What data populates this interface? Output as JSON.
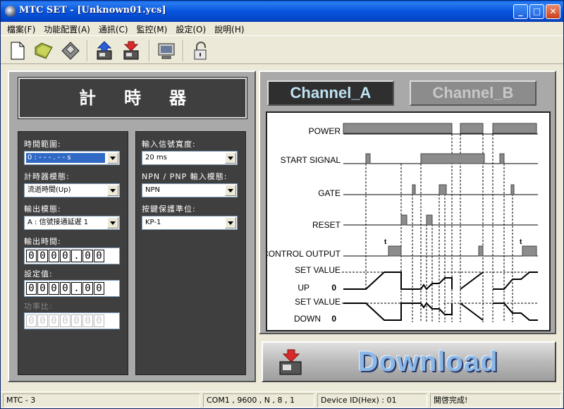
{
  "window": {
    "title": "MTC SET - [Unknown01.ycs]"
  },
  "menu": [
    "檔案(F)",
    "功能配置(A)",
    "通訊(C)",
    "監控(M)",
    "設定(O)",
    "說明(H)"
  ],
  "toolbar": {
    "icons": [
      "new-file-icon",
      "open-folder-icon",
      "save-disk-icon",
      "upload-icon",
      "download-icon",
      "monitor-icon",
      "lock-icon"
    ]
  },
  "left_panel": {
    "title": "計時器",
    "fields": {
      "time_range_label": "時間範圍:",
      "time_range_value": "0 : - - - . - -  s",
      "timer_mode_label": "計時器模態:",
      "timer_mode_value": "流逝時間(Up)",
      "output_mode_label": "輸出模態:",
      "output_mode_value": "A : 信號接通延遲 1",
      "output_time_label": "輸出時間:",
      "output_time_digits": [
        "0",
        "0",
        "0",
        "0",
        ".",
        "0",
        "0"
      ],
      "set_value_label": "設定值:",
      "set_value_digits": [
        "0",
        "0",
        "0",
        "0",
        ".",
        "0",
        "0"
      ],
      "duty_ratio_label": "功率比:",
      "duty_ratio_digits": [
        "0",
        "0",
        "0",
        "0",
        "0",
        "0",
        "0"
      ],
      "input_width_label": "輸入信號寬度:",
      "input_width_value": "20 ms",
      "npn_pnp_label": "NPN / PNP 輸入模態:",
      "npn_pnp_value": "NPN",
      "key_protect_label": "按鍵保護準位:",
      "key_protect_value": "KP-1"
    }
  },
  "channels": {
    "a": "Channel_A",
    "b": "Channel_B"
  },
  "diagram": {
    "labels": {
      "power": "POWER",
      "start": "START  SIGNAL",
      "gate": "GATE",
      "reset": "RESET",
      "control": "CONTROL  OUTPUT",
      "set_value_1": "SET VALUE",
      "up": "UP",
      "zero_1": "0",
      "set_value_2": "SET VALUE",
      "down": "DOWN",
      "zero_2": "0",
      "t": "t"
    }
  },
  "download_button": {
    "label": "Download"
  },
  "status": {
    "model": "MTC - 3",
    "comm": "COM1 , 9600 , N , 8 , 1",
    "device_id": "Device ID(Hex) : 01",
    "message": "開啓完成!"
  },
  "colors": {
    "title_blue": "#0855DD",
    "panel_gray": "#A9A9A9",
    "panel_dark": "#3F3F3F",
    "channel_a_text": "#BFE3F2",
    "selection": "#316AC5"
  }
}
